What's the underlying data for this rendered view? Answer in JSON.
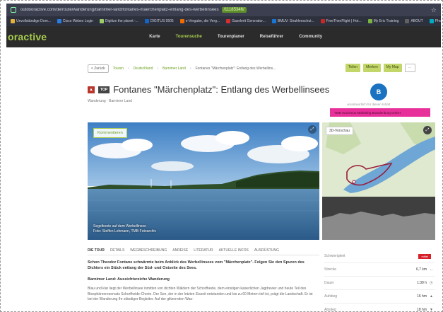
{
  "browser": {
    "url_prefix": "outdooractive.com/de/route/wanderung/barnimer-land/fontanes-maerchenplatz-entlang-des-werbellinsees",
    "url_highlight": "/11185346/",
    "bookmarks": [
      {
        "label": "Unvollständige Dom...",
        "color": "#e3b23c"
      },
      {
        "label": "Cisco Webex Login",
        "color": "#2a7de1"
      },
      {
        "label": "Digitize the planet -...",
        "color": "#9ccc65"
      },
      {
        "label": "DIGITUS 9505",
        "color": "#1565c0"
      },
      {
        "label": "e-Vergabe, die Verg...",
        "color": "#ef6c00"
      },
      {
        "label": "Gazelerit Generator...",
        "color": "#d32f2f"
      },
      {
        "label": "BMUV: Strahlenschut...",
        "color": "#1976d2"
      },
      {
        "label": "FreeThenFlight | Hot...",
        "color": "#c62828"
      },
      {
        "label": "My Eric Training",
        "color": "#7cb342"
      },
      {
        "label": "ABOUT",
        "color": "#616161"
      },
      {
        "label": "Photopea |",
        "color": "#00acc1"
      }
    ]
  },
  "site": {
    "logo": "oractive",
    "nav": [
      "Karte",
      "Tourensuche",
      "Tourenplaner",
      "Reiseführer",
      "Community"
    ],
    "nav_active_index": 1
  },
  "breadcrumb": {
    "back": "< Zurück",
    "items": [
      "Touren",
      "Deutschland",
      "Barnimer Land"
    ],
    "current": "Fontanes \"Märchenplatz\": Entlang des Werbellins..."
  },
  "actions": [
    "Teilen",
    "Merken",
    "My Map",
    "⋯"
  ],
  "tour": {
    "badge_top": "TOP",
    "title": "Fontanes \"Märchenplatz\": Entlang des Werbellinsees",
    "subline": "Wanderung · Barnimer Land",
    "author_initials": "B",
    "author_meta": "verantwortlich für diesen Inhalt",
    "author_highlight": "TMB Tourismus-Marketing Brandenburg GmbH"
  },
  "hero": {
    "comment_button": "Kommentieren",
    "caption_line1": "Segelboote auf dem Werbellinsee",
    "caption_line2": "Foto: Steffen Lehmann, TMB-Fotoarchiv"
  },
  "map": {
    "view_3d": "3D-Vorschau"
  },
  "tabs": [
    "DIE TOUR",
    "DETAILS",
    "WEGBESCHREIBUNG",
    "ANREISE",
    "LITERATUR",
    "AKTUELLE INFOS",
    "AUSRÜSTUNG"
  ],
  "content": {
    "lead": "Schon Theodor Fontane schwärmte beim Anblick des Werbellinsees vom \"Märchenplatz\". Folgen Sie den Spuren des Dichters ein Stück entlang der Süd- und Ostseite des Sees.",
    "heading": "Barnimer Land: Aussichtsreiche Wanderung",
    "body": "Blau und klar liegt der Werbellinsee inmitten von dichten Wäldern der Schorfheide, dem einstigen kaiserlichen Jagdrevier und heute Teil des Biosphärenreservats Schorfheide-Chorin. Der See, der in der letzten Eiszeit entstanden und bis zu 60 Metern tief ist, prägt die Landschaft. Er ist bei der Wanderung Ihr ständiger Begleiter. Auf der glitzernden Was-"
  },
  "stats": [
    {
      "key": "Schwierigkeit",
      "value": "mittel",
      "icon": ""
    },
    {
      "key": "Strecke",
      "value": "6,7 km",
      "icon": "↔"
    },
    {
      "key": "Dauer",
      "value": "1:39 h",
      "icon": "◷"
    },
    {
      "key": "Aufstieg",
      "value": "16 hm",
      "icon": "▲"
    },
    {
      "key": "Abstieg",
      "value": "18 hm",
      "icon": "▼"
    }
  ],
  "colors": {
    "brand_green": "#a8cd4e",
    "difficulty_red": "#d6202a",
    "highlight_pink": "#e8309a"
  }
}
